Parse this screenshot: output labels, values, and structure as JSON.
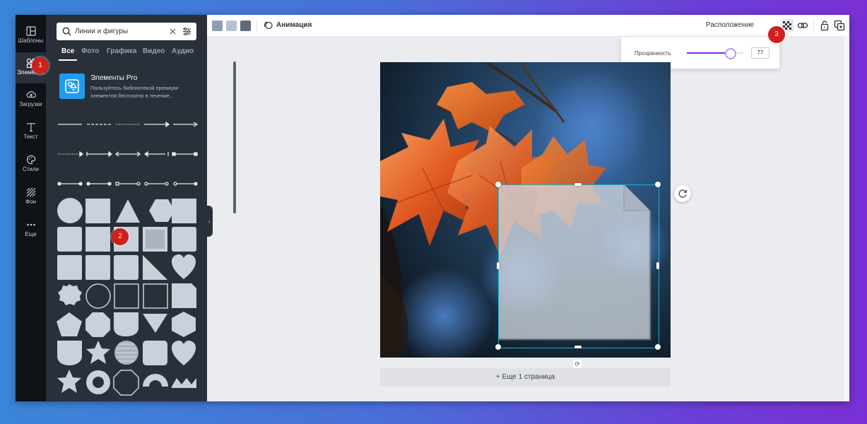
{
  "sidebar": {
    "items": [
      {
        "label": "Шаблоны",
        "icon": "templates-icon"
      },
      {
        "label": "Элементы",
        "icon": "elements-icon"
      },
      {
        "label": "Загрузки",
        "icon": "upload-icon"
      },
      {
        "label": "Текст",
        "icon": "text-icon"
      },
      {
        "label": "Стили",
        "icon": "palette-icon"
      },
      {
        "label": "Фон",
        "icon": "background-icon"
      },
      {
        "label": "Еще",
        "icon": "more-icon"
      }
    ]
  },
  "search": {
    "value": "Линии и фигуры",
    "placeholder": "Линии и фигуры"
  },
  "tabs": [
    "Все",
    "Фото",
    "Графика",
    "Видео",
    "Аудио"
  ],
  "pro": {
    "title": "Элементы Pro",
    "description": "Пользуйтесь библиотекой премиум-элементов бесплатно в течение..."
  },
  "toolbar": {
    "colors": [
      "#8f9eb0",
      "#b7c2cf",
      "#5f6b78"
    ],
    "animation_label": "Анимация",
    "layout_label": "Расположение"
  },
  "transparency": {
    "label": "Прозрачность",
    "value": "77",
    "level_percent": 77
  },
  "canvas": {
    "add_page_label": "+ Еще 1 страница"
  },
  "markers": [
    "1",
    "2",
    "3"
  ],
  "colors": {
    "accent": "#7d2ae8",
    "selection": "#18b3c8",
    "marker": "#d01f1f",
    "panel": "#293039",
    "rail": "#0e1318"
  }
}
